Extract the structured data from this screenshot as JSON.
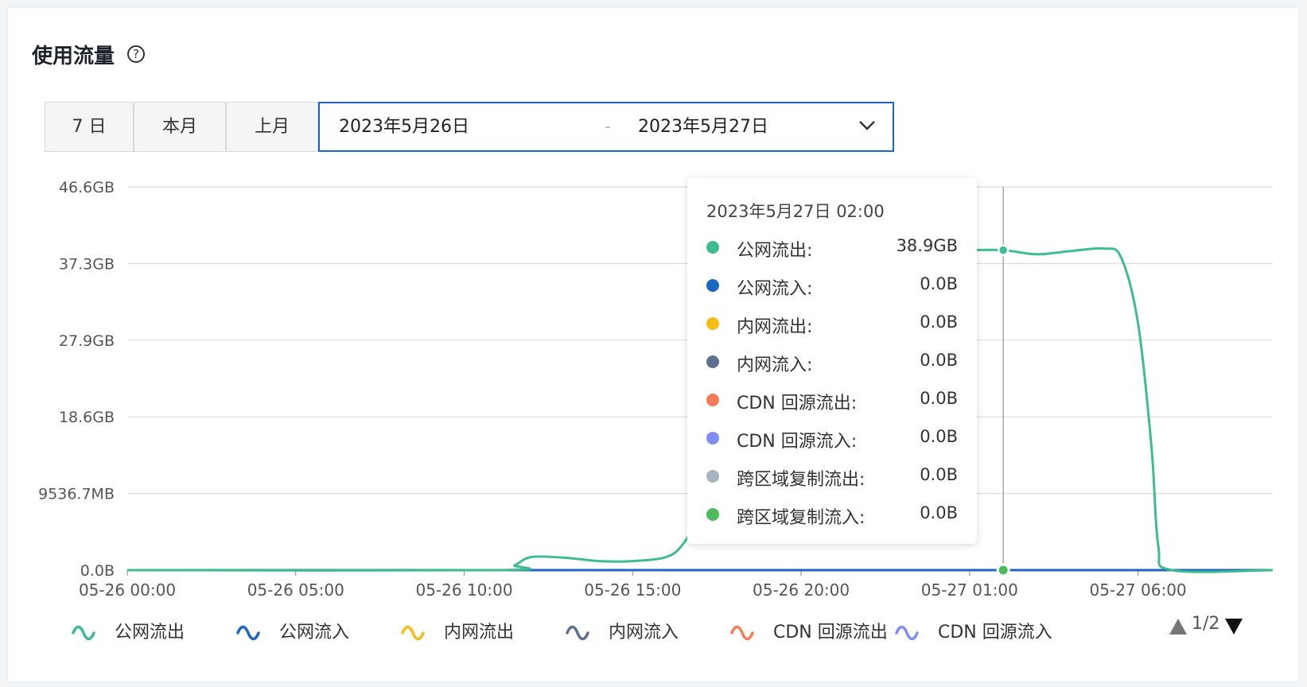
{
  "title": "使用流量",
  "help_icon": "question-circle-icon",
  "range_buttons": [
    "7 日",
    "本月",
    "上月"
  ],
  "date_range": {
    "start": "2023年5月26日",
    "separator": "-",
    "end": "2023年5月27日"
  },
  "colors": {
    "public_out": "#3dbd8f",
    "public_in": "#1a66c2",
    "private_out": "#f6bd16",
    "private_in": "#5d7092",
    "cdn_out": "#f57c58",
    "cdn_in": "#7f8cf5",
    "cross_out": "#a8b3c0",
    "cross_in": "#4cbb5a",
    "accent": "#1a66c2"
  },
  "chart_data": {
    "type": "line",
    "y_ticks": [
      "46.6GB",
      "37.3GB",
      "27.9GB",
      "18.6GB",
      "9536.7MB",
      "0.0B"
    ],
    "ylim_gb": [
      0,
      46.6
    ],
    "x_ticks": [
      "05-26 00:00",
      "05-26 05:00",
      "05-26 10:00",
      "05-26 15:00",
      "05-26 20:00",
      "05-27 01:00",
      "05-27 06:00"
    ],
    "x_unit": "hours since 05-26 00:00",
    "xlim": [
      0,
      34
    ],
    "grid": true,
    "series": [
      {
        "name": "公网流出",
        "color": "#3dbd8f",
        "points": [
          [
            0,
            0
          ],
          [
            11,
            0
          ],
          [
            11.5,
            0.6
          ],
          [
            12,
            1.6
          ],
          [
            13,
            1.5
          ],
          [
            14,
            1.1
          ],
          [
            15,
            1.1
          ],
          [
            16,
            1.6
          ],
          [
            16.5,
            3.2
          ],
          [
            17,
            7.0
          ],
          [
            17.6,
            15.0
          ],
          [
            18.3,
            30.5
          ],
          [
            18.7,
            29.8
          ],
          [
            19.2,
            25.0
          ],
          [
            20,
            20.0
          ],
          [
            21,
            20.0
          ],
          [
            22,
            20.0
          ],
          [
            23,
            22.0
          ],
          [
            23.5,
            30.0
          ],
          [
            24,
            37.0
          ],
          [
            24.5,
            38.8
          ],
          [
            25,
            38.9
          ],
          [
            26,
            38.9
          ],
          [
            27,
            38.4
          ],
          [
            28,
            38.8
          ],
          [
            29,
            39.1
          ],
          [
            29.5,
            38.0
          ],
          [
            30,
            30.0
          ],
          [
            30.4,
            15.0
          ],
          [
            30.6,
            3.0
          ],
          [
            31,
            0
          ],
          [
            34,
            0
          ]
        ]
      },
      {
        "name": "公网流入",
        "color": "#1a66c2",
        "points": [
          [
            0,
            0
          ],
          [
            34,
            0
          ]
        ]
      },
      {
        "name": "内网流出",
        "color": "#f6bd16",
        "points": [
          [
            0,
            0
          ],
          [
            34,
            0
          ]
        ]
      },
      {
        "name": "内网流入",
        "color": "#5d7092",
        "points": [
          [
            0,
            0
          ],
          [
            34,
            0
          ]
        ]
      },
      {
        "name": "CDN 回源流出",
        "color": "#f57c58",
        "points": [
          [
            0,
            0
          ],
          [
            34,
            0
          ]
        ]
      },
      {
        "name": "CDN 回源流入",
        "color": "#7f8cf5",
        "points": [
          [
            0,
            0
          ],
          [
            34,
            0
          ]
        ]
      },
      {
        "name": "跨区域复制流出",
        "color": "#a8b3c0",
        "points": [
          [
            0,
            0
          ],
          [
            34,
            0
          ]
        ]
      },
      {
        "name": "跨区域复制流入",
        "color": "#4cbb5a",
        "points": [
          [
            0,
            0
          ],
          [
            34,
            0
          ]
        ]
      }
    ],
    "hover_x": 26
  },
  "tooltip": {
    "title": "2023年5月27日 02:00",
    "rows": [
      {
        "label": "公网流出:",
        "value": "38.9GB",
        "color": "#3dbd8f"
      },
      {
        "label": "公网流入:",
        "value": "0.0B",
        "color": "#1a66c2"
      },
      {
        "label": "内网流出:",
        "value": "0.0B",
        "color": "#f6bd16"
      },
      {
        "label": "内网流入:",
        "value": "0.0B",
        "color": "#5d7092"
      },
      {
        "label": "CDN 回源流出:",
        "value": "0.0B",
        "color": "#f57c58"
      },
      {
        "label": "CDN 回源流入:",
        "value": "0.0B",
        "color": "#7f8cf5"
      },
      {
        "label": "跨区域复制流出:",
        "value": "0.0B",
        "color": "#a8b3c0"
      },
      {
        "label": "跨区域复制流入:",
        "value": "0.0B",
        "color": "#4cbb5a"
      }
    ]
  },
  "legend": [
    {
      "label": "公网流出",
      "color": "#3dbd8f"
    },
    {
      "label": "公网流入",
      "color": "#1a66c2"
    },
    {
      "label": "内网流出",
      "color": "#f6bd16"
    },
    {
      "label": "内网流入",
      "color": "#5d7092"
    },
    {
      "label": "CDN 回源流出",
      "color": "#f57c58"
    },
    {
      "label": "CDN 回源流入",
      "color": "#7f8cf5"
    }
  ],
  "legend_pager": "1/2"
}
